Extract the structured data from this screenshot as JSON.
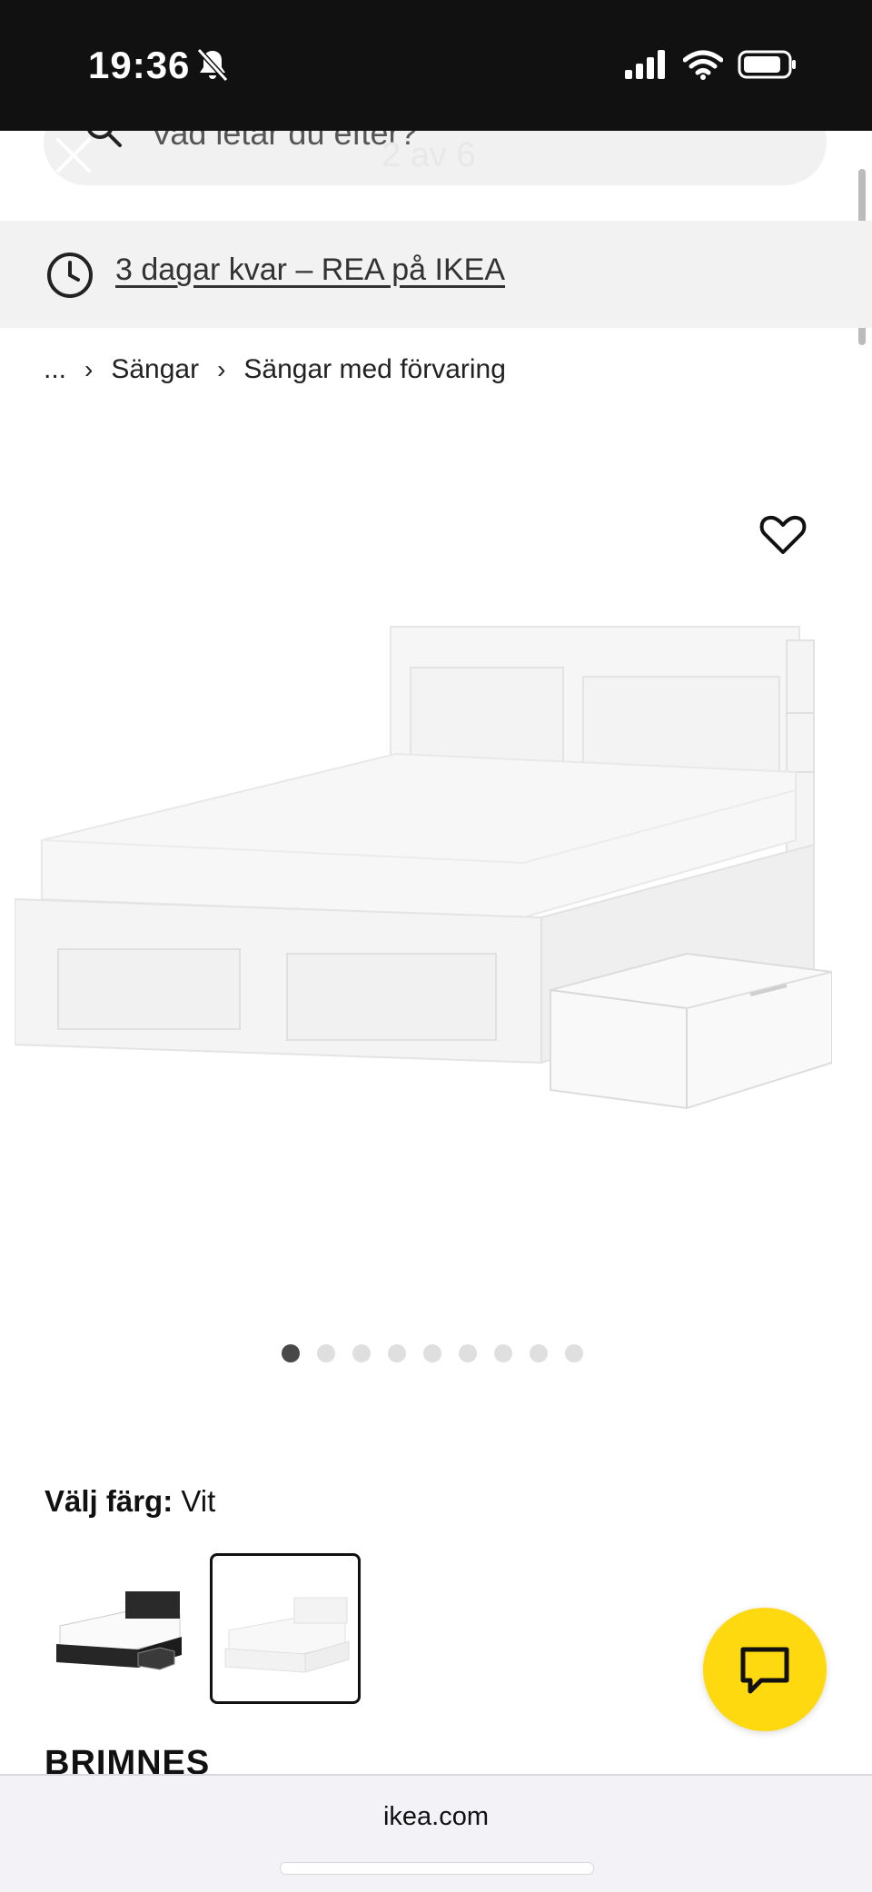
{
  "status_bar": {
    "time": "19:36"
  },
  "search": {
    "placeholder": "Vad letar du efter?"
  },
  "gallery": {
    "counter": "2 av 6",
    "dot_count": 9,
    "active_index": 0
  },
  "promo": {
    "text": "3 dagar kvar – REA på IKEA"
  },
  "breadcrumb": {
    "ellipsis": "...",
    "items": [
      "Sängar",
      "Sängar med förvaring"
    ]
  },
  "color_selector": {
    "label": "Välj färg:",
    "value": "Vit"
  },
  "product": {
    "name": "BRIMNES"
  },
  "browser": {
    "domain": "ikea.com"
  },
  "colors": {
    "accent": "#ffd90f",
    "status_bar": "#111111"
  }
}
